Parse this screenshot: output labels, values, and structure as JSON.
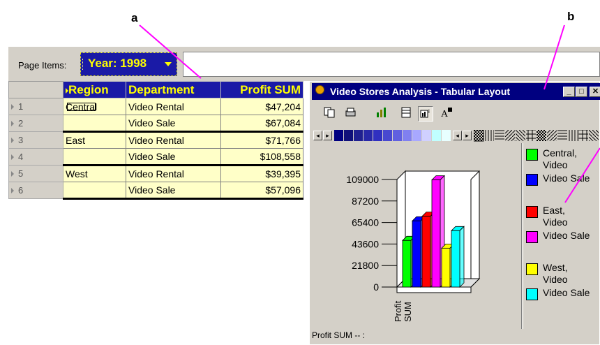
{
  "callouts": {
    "a": "a",
    "b": "b"
  },
  "page_items": {
    "label": "Page Items:",
    "year_value": "Year: 1998"
  },
  "table": {
    "headers": [
      "Region",
      "Department",
      "Profit SUM"
    ],
    "rows": [
      {
        "num": "1",
        "region": "Central",
        "department": "Video Rental",
        "profit": "$47,204"
      },
      {
        "num": "2",
        "region": "",
        "department": "Video Sale",
        "profit": "$67,084"
      },
      {
        "num": "3",
        "region": "East",
        "department": "Video Rental",
        "profit": "$71,766"
      },
      {
        "num": "4",
        "region": "",
        "department": "Video Sale",
        "profit": "$108,558"
      },
      {
        "num": "5",
        "region": "West",
        "department": "Video Rental",
        "profit": "$39,395"
      },
      {
        "num": "6",
        "region": "",
        "department": "Video Sale",
        "profit": "$57,096"
      }
    ]
  },
  "window": {
    "title": "Video Stores Analysis - Tabular Layout",
    "min_glyph": "_",
    "max_glyph": "□",
    "close_glyph": "✕",
    "status": "Profit SUM -- :"
  },
  "toolbar_icons": [
    "copy-icon",
    "print-icon",
    "bar-chart-icon",
    "table-layout-icon",
    "chart-layout-icon",
    "font-icon"
  ],
  "palette_colors": [
    "#000080",
    "#10107a",
    "#202090",
    "#2828a8",
    "#3030c0",
    "#4848d0",
    "#6060e0",
    "#8080f0",
    "#a8a8ff",
    "#d0d0ff",
    "#c0ffff",
    "#e8ffff"
  ],
  "chart_data": {
    "type": "bar",
    "subtype": "3d-bar",
    "categories": [
      "Profit SUM"
    ],
    "series": [
      {
        "name": "Central, Video Rental",
        "color": "#00ff00",
        "value": 47204
      },
      {
        "name": "Central, Video Sale",
        "color": "#0000ff",
        "value": 67084
      },
      {
        "name": "East, Video Rental",
        "color": "#ff0000",
        "value": 71766
      },
      {
        "name": "East, Video Sale",
        "color": "#ff00ff",
        "value": 108558
      },
      {
        "name": "West, Video Rental",
        "color": "#ffff00",
        "value": 39395
      },
      {
        "name": "West, Video Sale",
        "color": "#00ffff",
        "value": 57096
      }
    ],
    "yticks": [
      "109000",
      "87200",
      "65400",
      "43600",
      "21800",
      "0"
    ],
    "ylim": [
      0,
      109000
    ],
    "xlabel": "Profit SUM"
  },
  "legend": [
    {
      "line1": "Central,",
      "line2": "Video",
      "color": "#00ff00"
    },
    {
      "line1": "Video Sale",
      "line2": "",
      "color": "#0000ff"
    },
    {
      "line1": "East,",
      "line2": "Video",
      "color": "#ff0000"
    },
    {
      "line1": "Video Sale",
      "line2": "",
      "color": "#ff00ff"
    },
    {
      "line1": "West,",
      "line2": "Video",
      "color": "#ffff00"
    },
    {
      "line1": "Video Sale",
      "line2": "",
      "color": "#00ffff"
    }
  ]
}
